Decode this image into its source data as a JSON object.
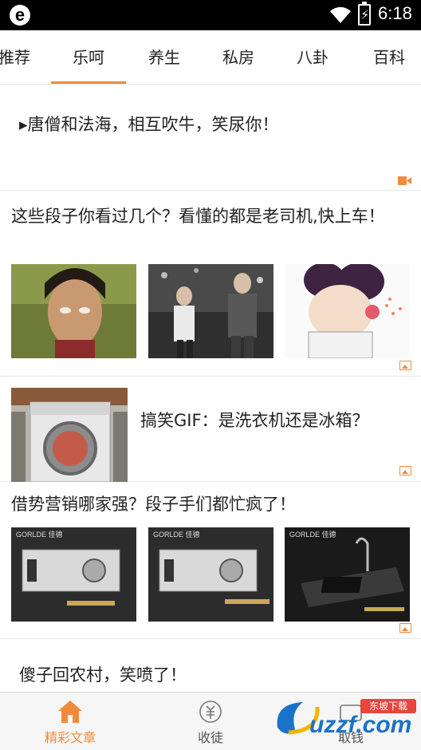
{
  "status_bar": {
    "time": "6:18",
    "app_logo": "e"
  },
  "tabs": [
    {
      "label": "推荐",
      "active": false
    },
    {
      "label": "乐呵",
      "active": true
    },
    {
      "label": "养生",
      "active": false
    },
    {
      "label": "私房",
      "active": false
    },
    {
      "label": "八卦",
      "active": false
    },
    {
      "label": "百科",
      "active": false
    }
  ],
  "feed": {
    "items": [
      {
        "title": "▸唐僧和法海，相互吹牛，笑尿你！",
        "type": "video",
        "icon": "video-icon"
      },
      {
        "title": "这些段子你看过几个？看懂的都是老司机,快上车！",
        "type": "gallery",
        "icon": "image-icon"
      },
      {
        "title": "搞笑GIF：是洗衣机还是冰箱？",
        "type": "single-image",
        "icon": "image-icon"
      },
      {
        "title": "借势营销哪家强？段子手们都忙疯了！",
        "type": "gallery",
        "icon": "image-icon",
        "ad_brand": "GORLDE 佳德"
      },
      {
        "title": "傻子回农村，笑喷了！",
        "type": "text"
      }
    ]
  },
  "bottom_nav": [
    {
      "label": "精彩文章",
      "icon": "home-icon",
      "active": true
    },
    {
      "label": "收徒",
      "icon": "sheep-icon",
      "active": false
    },
    {
      "label": "取钱",
      "icon": "wallet-icon",
      "active": false
    }
  ],
  "watermark": {
    "text": "uzzf.com",
    "badge": "东坡下载"
  },
  "colors": {
    "accent": "#f08a3c",
    "status_bar": "#000000",
    "divider": "#e6e6e6"
  }
}
